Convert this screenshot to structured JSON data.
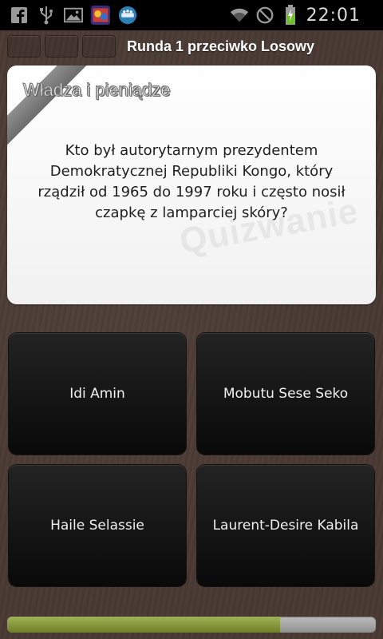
{
  "status_bar": {
    "time": "22:01",
    "icons": [
      "facebook-icon",
      "usb-icon",
      "gallery-icon",
      "game-app-icon",
      "quiz-app-icon",
      "wifi-icon",
      "do-not-disturb-icon",
      "battery-charging-icon"
    ]
  },
  "header": {
    "round_title": "Runda 1 przeciwko Losowy",
    "round_boxes": 3
  },
  "question_card": {
    "category": "Władza i pieniądze",
    "question": "Kto był autorytarnym prezydentem Demokratycznej Republiki Kongo, który rządził od 1965 do 1997 roku i często nosił czapkę z lamparciej skóry?",
    "watermark": "Quizwanie"
  },
  "answers": [
    {
      "label": "Idi Amin"
    },
    {
      "label": "Mobutu Sese Seko"
    },
    {
      "label": "Haile Selassie"
    },
    {
      "label": "Laurent-Desire Kabila"
    }
  ],
  "timer": {
    "progress_fraction": 0.74
  },
  "colors": {
    "background": "#4a3a33",
    "progress_fill": "#849637",
    "answer_bg": "#111111"
  }
}
